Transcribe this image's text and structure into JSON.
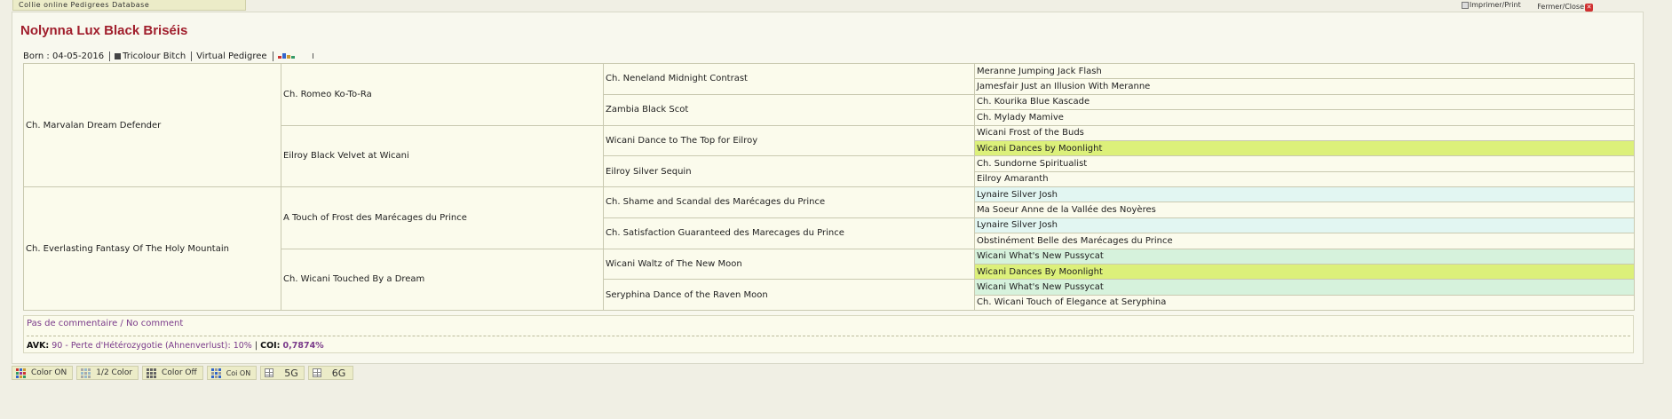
{
  "app": {
    "db_title": "Collie online Pedigrees Database"
  },
  "top_links": {
    "print": "Imprimer/Print",
    "close": "Fermer/Close"
  },
  "dog": {
    "name": "Nolynna Lux Black Briséis",
    "born": "Born : 04-05-2016",
    "sex_color": "Tricolour Bitch",
    "virtual_pedigree": "Virtual Pedigree"
  },
  "pedigree": {
    "gen1": [
      "Ch. Marvalan Dream Defender",
      "Ch. Everlasting Fantasy Of The Holy Mountain"
    ],
    "gen2": [
      "Ch. Romeo Ko-To-Ra",
      "Eilroy Black Velvet at Wicani",
      "A Touch of Frost des Marécages du Prince",
      "Ch. Wicani Touched By a Dream"
    ],
    "gen3": [
      "Ch. Neneland Midnight Contrast",
      "Zambia Black Scot",
      "Wicani Dance to The Top for Eilroy",
      "Eilroy Silver Sequin",
      "Ch. Shame and Scandal des Marécages du Prince",
      "Ch. Satisfaction Guaranteed des Marecages du Prince",
      "Wicani Waltz of The New Moon",
      "Seryphina Dance of the Raven Moon"
    ],
    "gen4": [
      {
        "name": "Meranne Jumping Jack Flash",
        "color": "#fbfbec"
      },
      {
        "name": "Jamesfair Just an Illusion With Meranne",
        "color": "#fbfbec"
      },
      {
        "name": "Ch. Kourika Blue Kascade",
        "color": "#fbfbec"
      },
      {
        "name": "Ch. Mylady Mamive",
        "color": "#fbfbec"
      },
      {
        "name": "Wicani Frost of the Buds",
        "color": "#fbfbec"
      },
      {
        "name": "Wicani Dances by Moonlight",
        "color": "#dcf07a"
      },
      {
        "name": "Ch. Sundorne Spiritualist",
        "color": "#fbfbec"
      },
      {
        "name": "Eilroy Amaranth",
        "color": "#fbfbec"
      },
      {
        "name": "Lynaire Silver Josh",
        "color": "#e2f6f2"
      },
      {
        "name": "Ma Soeur Anne de la Vallée des Noyères",
        "color": "#fbfbec"
      },
      {
        "name": "Lynaire Silver Josh",
        "color": "#e2f6f2"
      },
      {
        "name": "Obstinément Belle des Marécages du Prince",
        "color": "#fbfbec"
      },
      {
        "name": "Wicani What's New Pussycat",
        "color": "#d6f2dc"
      },
      {
        "name": "Wicani Dances By Moonlight",
        "color": "#dcf07a"
      },
      {
        "name": "Wicani What's New Pussycat",
        "color": "#d6f2dc"
      },
      {
        "name": "Ch. Wicani Touch of Elegance at Seryphina",
        "color": "#fbfbec"
      }
    ]
  },
  "comment": "Pas de commentaire / No comment",
  "stats": {
    "avk_label": "AVK:",
    "avk_value": "90",
    "avk_desc": "- Perte d'Hétérozygotie (Ahnenverlust): 10%",
    "separator": "|",
    "coi_label": "COI:",
    "coi_value": "0,7874%"
  },
  "buttons": {
    "color_on": "Color ON",
    "half_color": "1/2 Color",
    "color_off": "Color Off",
    "coi_on": "Coi ON",
    "gen5": "5G",
    "gen6": "6G"
  },
  "colors": {
    "title": "#a01e2c",
    "accent_purple": "#7a3a8a",
    "highlight_yellow": "#dcf07a",
    "highlight_blue": "#e2f6f2",
    "highlight_green": "#d6f2dc"
  }
}
